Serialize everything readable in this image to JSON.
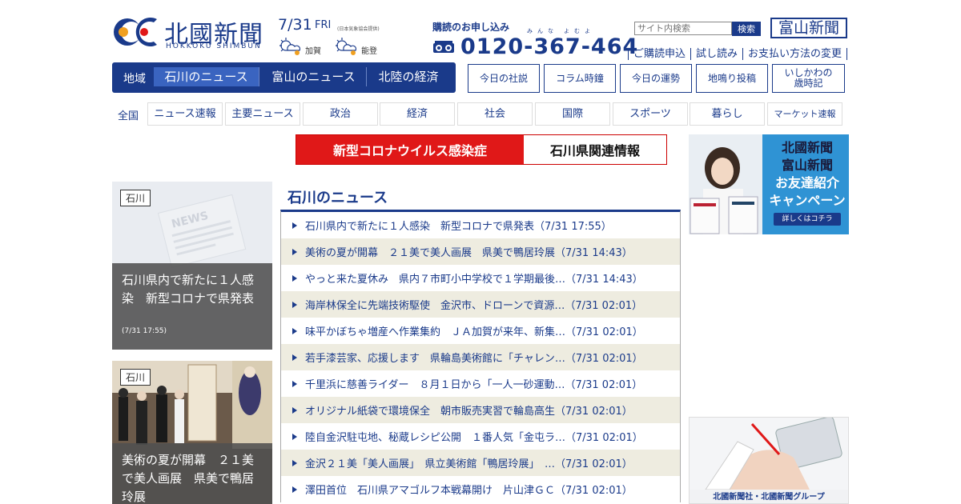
{
  "header": {
    "logo_text": "北國新聞",
    "logo_sub": "HOKKOKU SHIMBUN",
    "date": "7/31",
    "day_of_week": "FRI",
    "weather_source": "(日本気象協会提供)",
    "weather": [
      {
        "region": "加賀",
        "icon": "cloud-sun-icon"
      },
      {
        "region": "能登",
        "icon": "cloud-sun-icon"
      }
    ],
    "subscribe_label": "購読のお申し込み",
    "phone_ruby_1": "みんな",
    "phone_ruby_2": "よむよ",
    "phone": "0120-367-464",
    "search_placeholder": "サイト内検索",
    "search_button": "検索",
    "toyama_logo": "富山新聞",
    "top_links": [
      "ご購読申込",
      "試し読み",
      "お支払い方法の変更"
    ]
  },
  "region_nav": {
    "label": "地域",
    "tabs": [
      "石川のニュース",
      "富山のニュース",
      "北陸の経済"
    ],
    "active": 0
  },
  "feature_buttons": [
    "今日の社説",
    "コラム時鐘",
    "今日の運勢",
    "地鳴り投稿",
    "いしかわの\n歳時記"
  ],
  "categories": {
    "all_label": "全国",
    "items": [
      "ニュース速報",
      "主要ニュース",
      "政治",
      "経済",
      "社会",
      "国際",
      "スポーツ",
      "暮らし",
      "マーケット速報"
    ]
  },
  "banner": {
    "left": "新型コロナウイルス感染症",
    "right": "石川県関連情報",
    "accent": "#e01818"
  },
  "featured": [
    {
      "tag": "石川",
      "title": "石川県内で新たに１人感染　新型コロナで県発表",
      "time": "(7/31 17:55)",
      "image": "newspaper-placeholder"
    },
    {
      "tag": "石川",
      "title": "美術の夏が開幕　２１美で美人画展　県美で鴨居玲展",
      "time": "",
      "image": "gallery-photo"
    }
  ],
  "news": {
    "title": "石川のニュース",
    "items": [
      "石川県内で新たに１人感染　新型コロナで県発表（7/31 17:55）",
      "美術の夏が開幕　２１美で美人画展　県美で鴨居玲展（7/31 14:43）",
      "やっと来た夏休み　県内７市町小中学校で１学期最後…（7/31 14:43）",
      "海岸林保全に先端技術駆使　金沢市、ドローンで資源…（7/31 02:01）",
      "味平かぼちゃ増産へ作業集約　ＪＡ加賀が来年、新集…（7/31 02:01）",
      "若手漆芸家、応援します　県輪島美術館に「チャレン…（7/31 02:01）",
      "千里浜に慈善ライダー　８月１日から「一人一砂運動…（7/31 02:01）",
      "オリジナル紙袋で環境保全　朝市販売実習で輪島高生（7/31 02:01）",
      "陸自金沢駐屯地、秘蔵レシピ公開　１番人気「金屯ラ…（7/31 02:01）",
      "金沢２１美「美人画展」　県立美術館「鴨居玲展」　…（7/31 02:01）",
      "澤田首位　石川県アマゴルフ本戦幕開け　片山津ＧＣ（7/31 02:01）"
    ]
  },
  "ads": {
    "ad1_lines": [
      "北國新聞",
      "富山新聞",
      "お友達紹介",
      "キャンペーン"
    ],
    "ad1_button": "詳しくはコチラ",
    "ad2_caption": "北國新聞社・北國新聞グループ"
  },
  "colors": {
    "brand": "#1a3a8a",
    "accent": "#e01818",
    "stripe": "#eeece0"
  }
}
